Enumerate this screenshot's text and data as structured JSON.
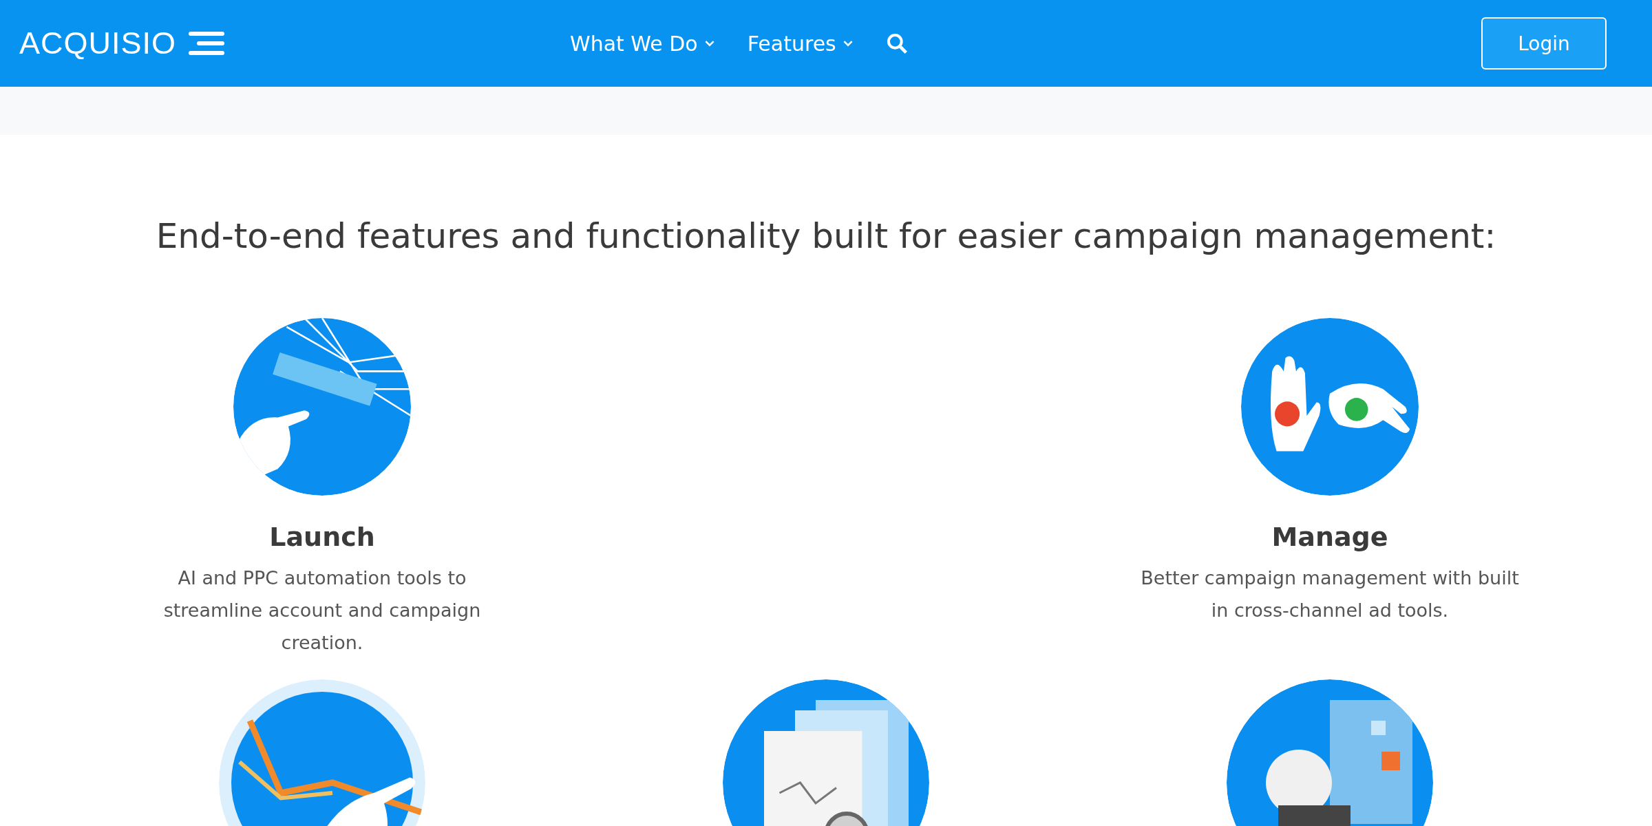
{
  "header": {
    "logo": "ACQUISIO",
    "nav": [
      {
        "label": "What We Do",
        "kind": "dropdown"
      },
      {
        "label": "Features",
        "kind": "dropdown"
      },
      {
        "kind": "search"
      }
    ],
    "login": "Login"
  },
  "heading": "End-to-end features and functionality built for easier campaign management:",
  "feature_rows": [
    {
      "left": {
        "kind": "launch",
        "title": "Launch",
        "description": "AI and PPC automation tools to streamline account and campaign creation."
      },
      "right": {
        "kind": "manage",
        "title": "Manage",
        "description": "Better campaign management with built in cross-channel ad tools."
      }
    },
    {
      "left": {
        "kind": "chart"
      },
      "center": {
        "kind": "documents"
      },
      "right": {
        "kind": "robot"
      }
    }
  ]
}
